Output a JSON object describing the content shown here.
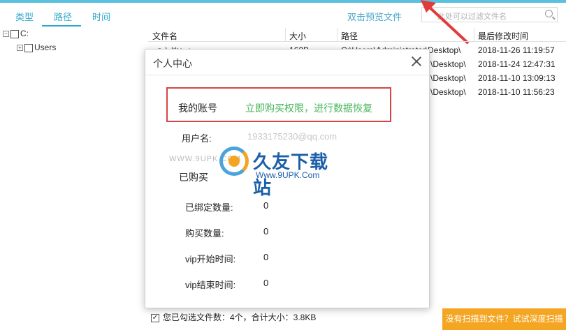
{
  "tabs": [
    "类型",
    "路径",
    "时间"
  ],
  "preview_link": "双击预览文件",
  "search": {
    "placeholder": "此处可以过滤文件名"
  },
  "tree": {
    "drive": "C:",
    "child": "Users",
    "collapse_glyph": "−",
    "expand_glyph": "+"
  },
  "columns": {
    "name": "文件名",
    "size": "大小",
    "path": "路径",
    "modified": "最后修改时间"
  },
  "rows": [
    {
      "name": "~$文档1.docx",
      "size": "162B",
      "path": "C:\\Users\\Administrator\\Desktop\\",
      "modified": "2018-11-26 11:19:57"
    },
    {
      "name": "",
      "size": "",
      "path": "\\Desktop\\",
      "modified": "2018-11-24 12:47:31"
    },
    {
      "name": "",
      "size": "",
      "path": "\\Desktop\\",
      "modified": "2018-11-10 13:09:13"
    },
    {
      "name": "",
      "size": "",
      "path": "\\Desktop\\",
      "modified": "2018-11-10 11:56:23"
    }
  ],
  "modal": {
    "title": "个人中心",
    "account_label": "我的账号",
    "buy_link": "立即购买权限，进行数据恢复",
    "user_label": "用户名:",
    "user_value": "1933175230@qq.com",
    "purchased_label": "已购买",
    "bound_label": "已绑定数量:",
    "bound_value": "0",
    "purchase_count_label": "购买数量:",
    "purchase_count_value": "0",
    "vip_start_label": "vip开始时间:",
    "vip_start_value": "0",
    "vip_end_label": "vip结束时间:",
    "vip_end_value": "0"
  },
  "watermark": {
    "title": "久友下载站",
    "sub": "Www.9UPK.Com",
    "www": "WWW.9UPK.COM"
  },
  "footer": {
    "check_glyph": "✓",
    "summary": "您已勾选文件数：4个，合计大小：3.8KB"
  },
  "deep_scan_button": "没有扫描到文件？试试深度扫描",
  "colors": {
    "accent": "#2fa7c9",
    "highlight_box": "#d64545",
    "buy_link": "#46b45a",
    "deep_button": "#f4a623"
  }
}
